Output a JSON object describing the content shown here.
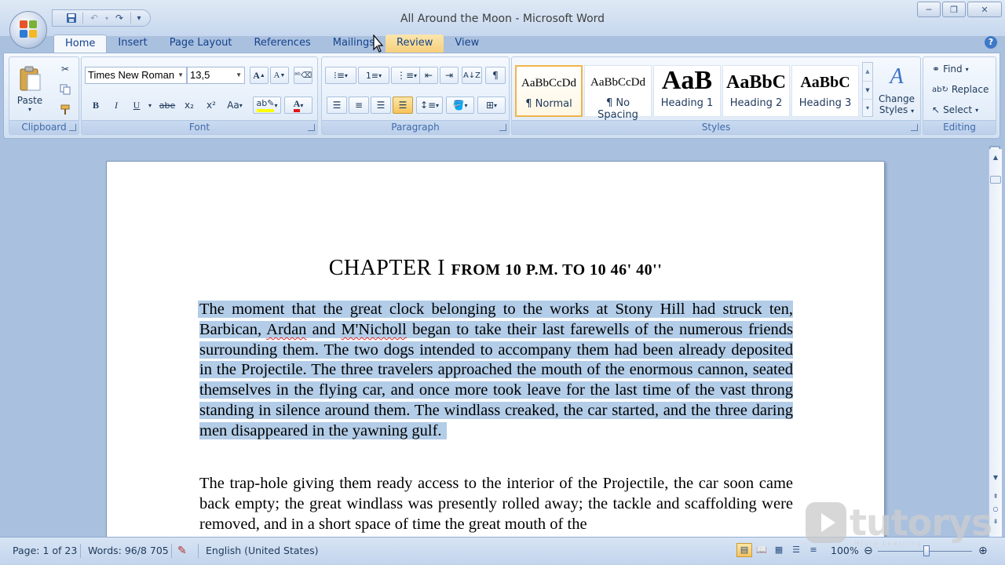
{
  "window": {
    "title": "All Around the Moon - Microsoft Word",
    "minimize": "─",
    "restore": "❐",
    "close": "✕"
  },
  "qat": {
    "save": "💾",
    "undo": "↶",
    "redo": "↷",
    "more": "▾"
  },
  "tabs": [
    {
      "label": "Home"
    },
    {
      "label": "Insert"
    },
    {
      "label": "Page Layout"
    },
    {
      "label": "References"
    },
    {
      "label": "Mailings"
    },
    {
      "label": "Review"
    },
    {
      "label": "View"
    }
  ],
  "ribbon": {
    "clipboard": {
      "label": "Clipboard",
      "paste": "Paste"
    },
    "font": {
      "label": "Font",
      "name": "Times New Roman",
      "size": "13,5",
      "bold": "B",
      "italic": "I",
      "underline": "U",
      "strike": "abe",
      "subscript": "x₂",
      "superscript": "x²",
      "case": "Aa",
      "grow": "A",
      "shrink": "A",
      "color_accent": "#e01818",
      "highlight_accent": "#ffff00"
    },
    "paragraph": {
      "label": "Paragraph",
      "pilcrow": "¶"
    },
    "styles": {
      "label": "Styles",
      "items": [
        {
          "preview": "AaBbCcDd",
          "name": "¶ Normal"
        },
        {
          "preview": "AaBbCcDd",
          "name": "¶ No Spacing"
        },
        {
          "preview": "AaB",
          "name": "Heading 1"
        },
        {
          "preview": "AaBbC",
          "name": "Heading 2"
        },
        {
          "preview": "AaBbC",
          "name": "Heading 3"
        }
      ],
      "change": "Change",
      "change2": "Styles"
    },
    "editing": {
      "label": "Editing",
      "find": "Find",
      "replace": "Replace",
      "select": "Select"
    }
  },
  "document": {
    "chapter_main": "CHAPTER I",
    "chapter_sub": "FROM 10 P.M. TO 10 46' 40''",
    "para1": [
      "The moment that the great clock belonging to the works at Stony Hill had struck",
      "ten, Barbican, ",
      "Ardan",
      " and ",
      "M'Nicholl",
      " began to take their last farewells of the",
      "numerous friends surrounding them. The two dogs intended to accompany them",
      "had been already deposited in the Projectile. The three travelers approached the",
      "mouth of the enormous cannon, seated themselves in the flying car, and once more",
      "took leave for the last time of the vast throng standing in silence around them. The",
      "windlass creaked, the car started, and the three daring men disappeared in the",
      "yawning gulf."
    ],
    "para2": [
      "The trap-hole giving them ready access to the interior of the Projectile, the car soon",
      "came back empty; the great windlass was presently rolled away; the tackle and",
      "scaffolding were removed, and in a short space of time the great mouth of the"
    ]
  },
  "status": {
    "page": "Page: 1 of 23",
    "words": "Words: 96/8 705",
    "language": "English (United States)",
    "zoom": "100%"
  },
  "watermark": {
    "text": "tutorys",
    "tagline": "Micro Learning"
  }
}
